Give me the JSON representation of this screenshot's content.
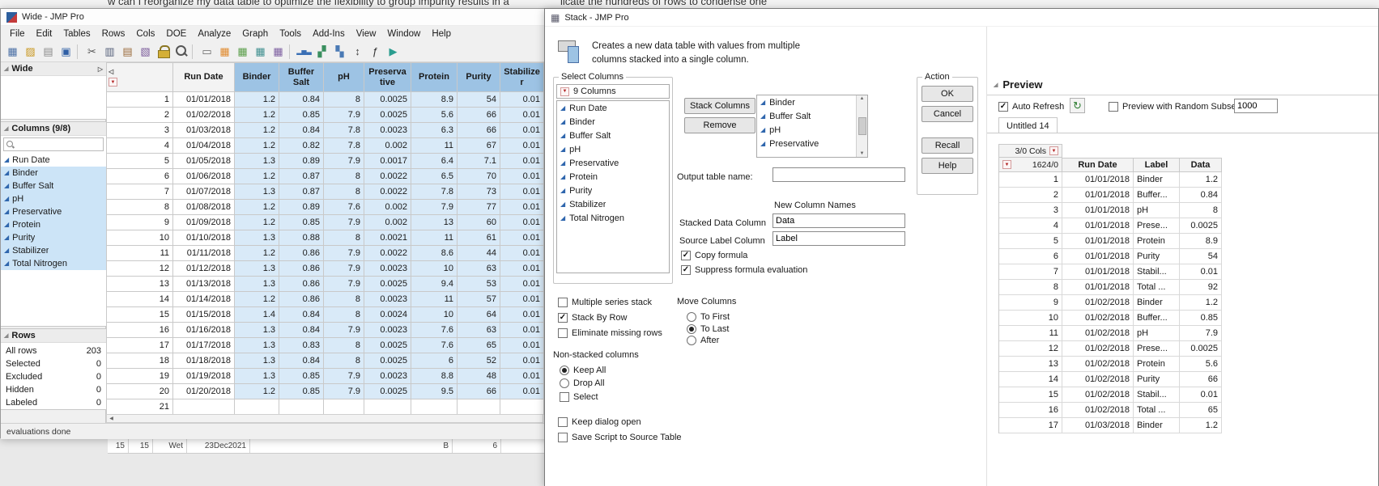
{
  "background": {
    "top_text_left": "w can I reorganize my data table to optimize the flexibility to group impurity results in a",
    "top_text_right": "licate the hundreds of rows to condense one",
    "bottom_fragment_cells": [
      "15",
      "15",
      "Wet",
      "23Dec2021",
      "B",
      "6"
    ]
  },
  "main_window": {
    "title": "Wide - JMP Pro",
    "menu_items": [
      "File",
      "Edit",
      "Tables",
      "Rows",
      "Cols",
      "DOE",
      "Analyze",
      "Graph",
      "Tools",
      "Add-Ins",
      "View",
      "Window",
      "Help"
    ],
    "toolbar_icons": [
      {
        "name": "new-data-table-icon",
        "glyph": "▦",
        "color": "#4a6fa5"
      },
      {
        "name": "open-icon",
        "glyph": "▨",
        "color": "#c9971f"
      },
      {
        "name": "new-journal-icon",
        "glyph": "▤",
        "color": "#8a8a8a"
      },
      {
        "name": "save-icon",
        "glyph": "▣",
        "color": "#2f5fa5"
      },
      {
        "name": "separator"
      },
      {
        "name": "cut-icon",
        "glyph": "✂",
        "color": "#555555"
      },
      {
        "name": "copy-icon",
        "glyph": "▥",
        "color": "#55607a"
      },
      {
        "name": "paste-icon",
        "glyph": "▤",
        "color": "#9a6a3a"
      },
      {
        "name": "format-painter-icon",
        "glyph": "▧",
        "color": "#7a5a9a"
      },
      {
        "name": "lock-icon",
        "glyph": "css:lock"
      },
      {
        "name": "search-icon",
        "glyph": "css:mag"
      },
      {
        "name": "separator"
      },
      {
        "name": "print-icon",
        "glyph": "▭",
        "color": "#666666"
      },
      {
        "name": "summary-table-icon",
        "glyph": "▦",
        "color": "#e08a2e"
      },
      {
        "name": "subset-table-icon",
        "glyph": "▦",
        "color": "#5a9e4a"
      },
      {
        "name": "sort-table-icon",
        "glyph": "▦",
        "color": "#3f8f8f"
      },
      {
        "name": "stack-table-icon",
        "glyph": "▦",
        "color": "#7d5fa0"
      },
      {
        "name": "separator"
      },
      {
        "name": "distribution-icon",
        "glyph": "▂▅▃",
        "color": "#3a6fb5"
      },
      {
        "name": "fit-y-by-x-icon",
        "glyph": "▞",
        "color": "#3a8f5f"
      },
      {
        "name": "graph-builder-icon",
        "glyph": "▚",
        "color": "#4a7ab5"
      },
      {
        "name": "sort-az-icon",
        "glyph": "↕",
        "color": "#444444"
      },
      {
        "name": "formula-icon",
        "glyph": "ƒ",
        "color": "#333333"
      },
      {
        "name": "run-script-icon",
        "glyph": "▶",
        "color": "#2a9d8f"
      }
    ],
    "sidebar": {
      "table_panel_title": "Wide",
      "columns_panel_title": "Columns (9/8)",
      "columns": [
        {
          "label": "Run Date",
          "selected": false
        },
        {
          "label": "Binder",
          "selected": true
        },
        {
          "label": "Buffer Salt",
          "selected": true
        },
        {
          "label": "pH",
          "selected": true
        },
        {
          "label": "Preservative",
          "selected": true
        },
        {
          "label": "Protein",
          "selected": true
        },
        {
          "label": "Purity",
          "selected": true
        },
        {
          "label": "Stabilizer",
          "selected": true
        },
        {
          "label": "Total Nitrogen",
          "selected": true
        }
      ],
      "rows_panel_title": "Rows",
      "row_stats": [
        {
          "label": "All rows",
          "value": "203"
        },
        {
          "label": "Selected",
          "value": "0"
        },
        {
          "label": "Excluded",
          "value": "0"
        },
        {
          "label": "Hidden",
          "value": "0"
        },
        {
          "label": "Labeled",
          "value": "0"
        }
      ]
    },
    "data_table": {
      "columns": [
        {
          "label": "Run Date",
          "selected": false
        },
        {
          "label": "Binder",
          "selected": true
        },
        {
          "label": "Buffer Salt",
          "selected": true
        },
        {
          "label": "pH",
          "selected": true
        },
        {
          "label": "Preservative",
          "selected": true
        },
        {
          "label": "Protein",
          "selected": true
        },
        {
          "label": "Purity",
          "selected": true
        },
        {
          "label": "Stabilizer",
          "selected": true
        }
      ],
      "rows": [
        [
          "1",
          "01/01/2018",
          "1.2",
          "0.84",
          "8",
          "0.0025",
          "8.9",
          "54",
          "0.01"
        ],
        [
          "2",
          "01/02/2018",
          "1.2",
          "0.85",
          "7.9",
          "0.0025",
          "5.6",
          "66",
          "0.01"
        ],
        [
          "3",
          "01/03/2018",
          "1.2",
          "0.84",
          "7.8",
          "0.0023",
          "6.3",
          "66",
          "0.01"
        ],
        [
          "4",
          "01/04/2018",
          "1.2",
          "0.82",
          "7.8",
          "0.002",
          "11",
          "67",
          "0.01"
        ],
        [
          "5",
          "01/05/2018",
          "1.3",
          "0.89",
          "7.9",
          "0.0017",
          "6.4",
          "7.1",
          "0.01"
        ],
        [
          "6",
          "01/06/2018",
          "1.2",
          "0.87",
          "8",
          "0.0022",
          "6.5",
          "70",
          "0.01"
        ],
        [
          "7",
          "01/07/2018",
          "1.3",
          "0.87",
          "8",
          "0.0022",
          "7.8",
          "73",
          "0.01"
        ],
        [
          "8",
          "01/08/2018",
          "1.2",
          "0.89",
          "7.6",
          "0.002",
          "7.9",
          "77",
          "0.01"
        ],
        [
          "9",
          "01/09/2018",
          "1.2",
          "0.85",
          "7.9",
          "0.002",
          "13",
          "60",
          "0.01"
        ],
        [
          "10",
          "01/10/2018",
          "1.3",
          "0.88",
          "8",
          "0.0021",
          "11",
          "61",
          "0.01"
        ],
        [
          "11",
          "01/11/2018",
          "1.2",
          "0.86",
          "7.9",
          "0.0022",
          "8.6",
          "44",
          "0.01"
        ],
        [
          "12",
          "01/12/2018",
          "1.3",
          "0.86",
          "7.9",
          "0.0023",
          "10",
          "63",
          "0.01"
        ],
        [
          "13",
          "01/13/2018",
          "1.3",
          "0.86",
          "7.9",
          "0.0025",
          "9.4",
          "53",
          "0.01"
        ],
        [
          "14",
          "01/14/2018",
          "1.2",
          "0.86",
          "8",
          "0.0023",
          "11",
          "57",
          "0.01"
        ],
        [
          "15",
          "01/15/2018",
          "1.4",
          "0.84",
          "8",
          "0.0024",
          "10",
          "64",
          "0.01"
        ],
        [
          "16",
          "01/16/2018",
          "1.3",
          "0.84",
          "7.9",
          "0.0023",
          "7.6",
          "63",
          "0.01"
        ],
        [
          "17",
          "01/17/2018",
          "1.3",
          "0.83",
          "8",
          "0.0025",
          "7.6",
          "65",
          "0.01"
        ],
        [
          "18",
          "01/18/2018",
          "1.3",
          "0.84",
          "8",
          "0.0025",
          "6",
          "52",
          "0.01"
        ],
        [
          "19",
          "01/19/2018",
          "1.3",
          "0.85",
          "7.9",
          "0.0023",
          "8.8",
          "48",
          "0.01"
        ],
        [
          "20",
          "01/20/2018",
          "1.2",
          "0.85",
          "7.9",
          "0.0025",
          "9.5",
          "66",
          "0.01"
        ],
        [
          "21",
          "",
          "",
          "",
          "",
          "",
          "",
          "",
          ""
        ]
      ]
    },
    "status_bar": "evaluations done"
  },
  "dialog": {
    "title": "Stack - JMP Pro",
    "description": "Creates a new data table with values from multiple columns stacked into a single column.",
    "select_columns": {
      "legend": "Select Columns",
      "header": "9 Columns",
      "items": [
        "Run Date",
        "Binder",
        "Buffer Salt",
        "pH",
        "Preservative",
        "Protein",
        "Purity",
        "Stabilizer",
        "Total Nitrogen"
      ]
    },
    "stack_columns_button": "Stack Columns",
    "remove_button": "Remove",
    "stacked_items": [
      "Binder",
      "Buffer Salt",
      "pH",
      "Preservative"
    ],
    "output_table_label": "Output table name:",
    "output_table_value": "",
    "new_column_names_label": "New Column Names",
    "stacked_data_label": "Stacked Data Column",
    "stacked_data_value": "Data",
    "source_label_label": "Source Label Column",
    "source_label_value": "Label",
    "checkboxes": {
      "copy_formula": {
        "label": "Copy formula",
        "checked": true
      },
      "suppress_formula": {
        "label": "Suppress formula evaluation",
        "checked": true
      },
      "multiple_series": {
        "label": "Multiple series stack",
        "checked": false
      },
      "stack_by_row": {
        "label": "Stack By Row",
        "checked": true
      },
      "eliminate_missing": {
        "label": "Eliminate missing rows",
        "checked": false
      },
      "select": {
        "label": "Select",
        "checked": false
      },
      "keep_dialog_open": {
        "label": "Keep dialog open",
        "checked": false
      },
      "save_script": {
        "label": "Save Script to Source Table",
        "checked": false
      }
    },
    "move_columns_label": "Move Columns",
    "move_options": [
      {
        "label": "To First",
        "selected": false
      },
      {
        "label": "To Last",
        "selected": true
      },
      {
        "label": "After",
        "selected": false
      }
    ],
    "non_stacked_label": "Non-stacked columns",
    "non_stacked_options": [
      {
        "label": "Keep All",
        "selected": true
      },
      {
        "label": "Drop All",
        "selected": false
      }
    ],
    "action": {
      "legend": "Action",
      "buttons": [
        "OK",
        "Cancel",
        "Recall",
        "Help"
      ]
    }
  },
  "preview": {
    "title": "Preview",
    "auto_refresh_label": "Auto Refresh",
    "auto_refresh_checked": true,
    "random_subset_label": "Preview with Random Subset",
    "random_subset_checked": false,
    "random_subset_value": "1000",
    "tab_label": "Untitled 14",
    "table": {
      "cols_header": "3/0 Cols",
      "rows_header": "1624/0",
      "columns": [
        "Run Date",
        "Label",
        "Data"
      ],
      "rows": [
        [
          "1",
          "01/01/2018",
          "Binder",
          "1.2"
        ],
        [
          "2",
          "01/01/2018",
          "Buffer...",
          "0.84"
        ],
        [
          "3",
          "01/01/2018",
          "pH",
          "8"
        ],
        [
          "4",
          "01/01/2018",
          "Prese...",
          "0.0025"
        ],
        [
          "5",
          "01/01/2018",
          "Protein",
          "8.9"
        ],
        [
          "6",
          "01/01/2018",
          "Purity",
          "54"
        ],
        [
          "7",
          "01/01/2018",
          "Stabil...",
          "0.01"
        ],
        [
          "8",
          "01/01/2018",
          "Total ...",
          "92"
        ],
        [
          "9",
          "01/02/2018",
          "Binder",
          "1.2"
        ],
        [
          "10",
          "01/02/2018",
          "Buffer...",
          "0.85"
        ],
        [
          "11",
          "01/02/2018",
          "pH",
          "7.9"
        ],
        [
          "12",
          "01/02/2018",
          "Prese...",
          "0.0025"
        ],
        [
          "13",
          "01/02/2018",
          "Protein",
          "5.6"
        ],
        [
          "14",
          "01/02/2018",
          "Purity",
          "66"
        ],
        [
          "15",
          "01/02/2018",
          "Stabil...",
          "0.01"
        ],
        [
          "16",
          "01/02/2018",
          "Total ...",
          "65"
        ],
        [
          "17",
          "01/03/2018",
          "Binder",
          "1.2"
        ]
      ]
    }
  }
}
